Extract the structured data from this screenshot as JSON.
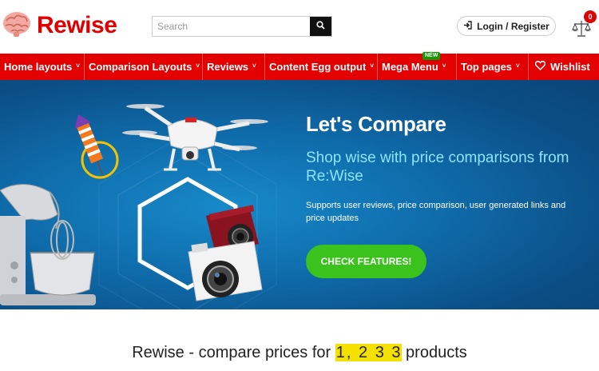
{
  "header": {
    "logo_text": "Rewise",
    "logo_icon": "brain-icon",
    "search": {
      "placeholder": "Search",
      "value": "",
      "icon": "search-icon"
    },
    "login_label": "Login / Register",
    "compare": {
      "icon": "scales-icon",
      "count": "0"
    }
  },
  "nav": {
    "items": [
      {
        "label": "Home layouts",
        "icon": "chevron-down-icon"
      },
      {
        "label": "Comparison Layouts",
        "icon": "chevron-down-icon"
      },
      {
        "label": "Reviews",
        "icon": "chevron-down-icon"
      },
      {
        "label": "Content Egg output",
        "icon": "chevron-down-icon"
      },
      {
        "label": "Mega Menu",
        "icon": "chevron-down-icon",
        "badge": "NEW"
      },
      {
        "label": "Top pages",
        "icon": "chevron-down-icon"
      },
      {
        "label": "Wishlist",
        "icon": "heart-icon"
      }
    ],
    "chevron_glyph": "˅"
  },
  "hero": {
    "title": "Let's Compare",
    "subtitle": "Shop wise with price comparisons from Re:Wise",
    "description": "Supports user reviews, price comparison, user generated links and price updates",
    "button_label": "CHECK FEATURES!"
  },
  "stats": {
    "prefix": "Rewise - compare prices for ",
    "count_digits": [
      "1",
      ",",
      " ",
      "2",
      " ",
      "3",
      " ",
      "3"
    ],
    "suffix": " products"
  },
  "colors": {
    "brand_red": "#e30000",
    "hero_blue": "#0f6cab",
    "accent_green": "#3cc21d",
    "highlight_yellow": "#f5e100",
    "subtitle_cyan": "#8fe4ff"
  }
}
